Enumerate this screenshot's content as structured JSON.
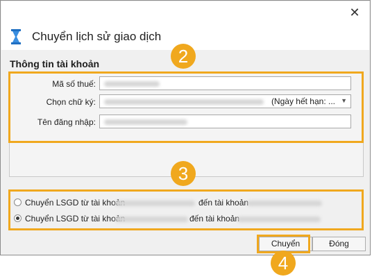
{
  "window": {
    "close_symbol": "✕"
  },
  "header": {
    "title": "Chuyển lịch sử giao dịch",
    "icon": "hourglass-icon"
  },
  "account_info": {
    "section_title": "Thông tin tài khoản",
    "tax_code_label": "Mã số thuế:",
    "signature_label": "Chọn chữ ký:",
    "signature_expiry": "(Ngày hết hạn: ...",
    "username_label": "Tên đăng nhập:"
  },
  "transfer_options": {
    "option1": {
      "prefix": "Chuyển LSGD từ tài khoản",
      "middle": "đến tài khoản",
      "selected": false
    },
    "option2": {
      "prefix": "Chuyển LSGD từ tài khoản",
      "middle": "đến tài khoản",
      "selected": true
    }
  },
  "buttons": {
    "transfer": "Chuyển",
    "close": "Đóng"
  },
  "callouts": {
    "badge2": "2",
    "badge3": "3",
    "badge4": "4"
  },
  "colors": {
    "highlight": "#f0a81e",
    "hourglass": "#1f6fc2"
  }
}
